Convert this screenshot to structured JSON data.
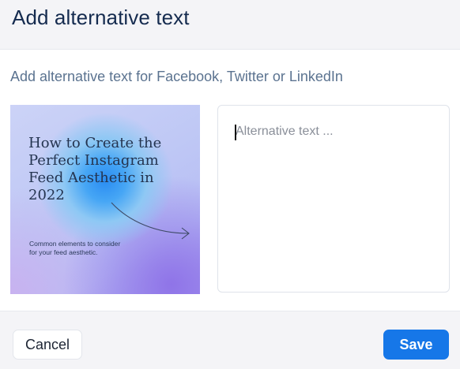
{
  "dialog": {
    "title": "Add alternative text",
    "subtitle": "Add alternative text for Facebook, Twitter or LinkedIn"
  },
  "thumbnail": {
    "headline": "How to Create the\nPerfect Instagram\nFeed Aesthetic in\n2022",
    "caption": "Common elements to consider\nfor your feed aesthetic."
  },
  "alt_text": {
    "value": "",
    "placeholder": "Alternative text ..."
  },
  "footer": {
    "cancel_label": "Cancel",
    "save_label": "Save"
  },
  "colors": {
    "title": "#152b4f",
    "subtitle": "#5b7390",
    "primary_button": "#1677e8",
    "panel_background": "#f4f4f7"
  },
  "icons": {
    "thumbnail_arrow": "curved-arrow-icon"
  }
}
